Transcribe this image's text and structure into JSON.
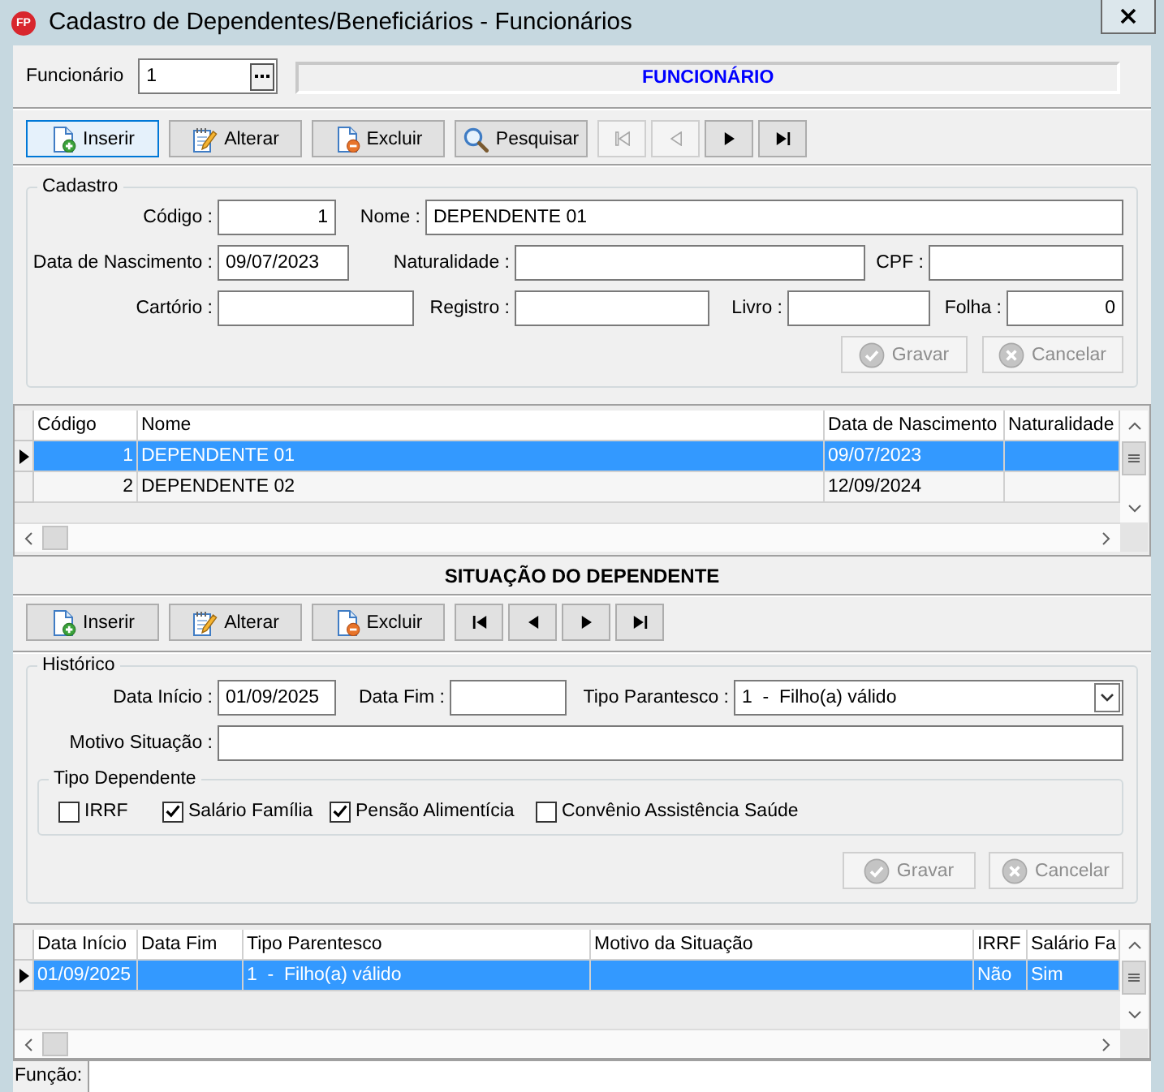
{
  "window": {
    "logo": "FP",
    "title": "Cadastro de Dependentes/Beneficiários - Funcionários"
  },
  "funcionario": {
    "label": "Funcionário",
    "value": "1",
    "display": "FUNCIONÁRIO"
  },
  "toolbar": {
    "buttons": [
      {
        "kind": "insert",
        "label": "Inserir",
        "focused": true
      },
      {
        "kind": "edit",
        "label": "Alterar",
        "focused": false
      },
      {
        "kind": "delete",
        "label": "Excluir",
        "focused": false
      },
      {
        "kind": "search",
        "label": "Pesquisar",
        "focused": false
      }
    ],
    "navigation": [
      {
        "kind": "first",
        "disabled": true
      },
      {
        "kind": "previous",
        "disabled": true
      },
      {
        "kind": "next",
        "disabled": false
      },
      {
        "kind": "last",
        "disabled": false
      }
    ]
  },
  "cadastro": {
    "title": "Cadastro",
    "codigo": {
      "label": "Código :",
      "value": "1"
    },
    "nome": {
      "label": "Nome :",
      "value": "DEPENDENTE 01"
    },
    "data_nascimento": {
      "label": "Data de Nascimento :",
      "value": "09/07/2023"
    },
    "naturalidade": {
      "label": "Naturalidade :"
    },
    "cpf": {
      "label": "CPF :"
    },
    "cartorio": {
      "label": "Cartório :"
    },
    "registro": {
      "label": "Registro :"
    },
    "livro": {
      "label": "Livro :"
    },
    "folha": {
      "label": "Folha :",
      "value": "0"
    },
    "actions": [
      {
        "kind": "save",
        "label": "Gravar",
        "disabled": true
      },
      {
        "kind": "cancel",
        "label": "Cancelar",
        "disabled": true
      }
    ]
  },
  "dependentes_grid": {
    "columns": [
      "Código",
      "Nome",
      "Data de Nascimento",
      "Naturalidade"
    ],
    "rows": [
      {
        "selected": true,
        "cells": [
          "1",
          "DEPENDENTE 01",
          "09/07/2023",
          null
        ]
      },
      {
        "selected": false,
        "cells": [
          "2",
          "DEPENDENTE 02",
          "12/09/2024",
          null
        ]
      }
    ]
  },
  "situacao": {
    "title": "SITUAÇÃO DO DEPENDENTE",
    "toolbar": {
      "buttons": [
        {
          "kind": "insert",
          "label": "Inserir",
          "focused": false
        },
        {
          "kind": "edit",
          "label": "Alterar",
          "focused": false
        },
        {
          "kind": "delete",
          "label": "Excluir",
          "focused": false
        }
      ],
      "navigation": [
        {
          "kind": "first",
          "disabled": false
        },
        {
          "kind": "previous",
          "disabled": false
        },
        {
          "kind": "next",
          "disabled": false
        },
        {
          "kind": "last",
          "disabled": false
        }
      ]
    },
    "historico": {
      "title": "Histórico",
      "data_inicio": {
        "label": "Data Início :",
        "value": "01/09/2025"
      },
      "data_fim": {
        "label": "Data Fim :"
      },
      "tipo_parentesco": {
        "label": "Tipo Parantesco :",
        "value": "1  -  Filho(a) válido"
      },
      "motivo": {
        "label": "Motivo Situação :"
      },
      "tipo_dependente": {
        "title": "Tipo Dependente",
        "options": [
          {
            "label": "IRRF",
            "checked": false
          },
          {
            "label": "Salário Família",
            "checked": true
          },
          {
            "label": "Pensão Alimentícia",
            "checked": true
          },
          {
            "label": "Convênio Assistência Saúde",
            "checked": false
          }
        ]
      },
      "actions": [
        {
          "kind": "save",
          "label": "Gravar",
          "disabled": true
        },
        {
          "kind": "cancel",
          "label": "Cancelar",
          "disabled": true
        }
      ]
    },
    "grid": {
      "columns": [
        "Data Início",
        "Data Fim",
        "Tipo Parentesco",
        "Motivo da Situação",
        "IRRF",
        "Salário Fa"
      ],
      "rows": [
        {
          "selected": true,
          "cells": [
            "01/09/2025",
            null,
            "1  -  Filho(a) válido",
            null,
            "Não",
            "Sim"
          ]
        }
      ]
    }
  },
  "status_bar": {
    "label": "Função:"
  }
}
